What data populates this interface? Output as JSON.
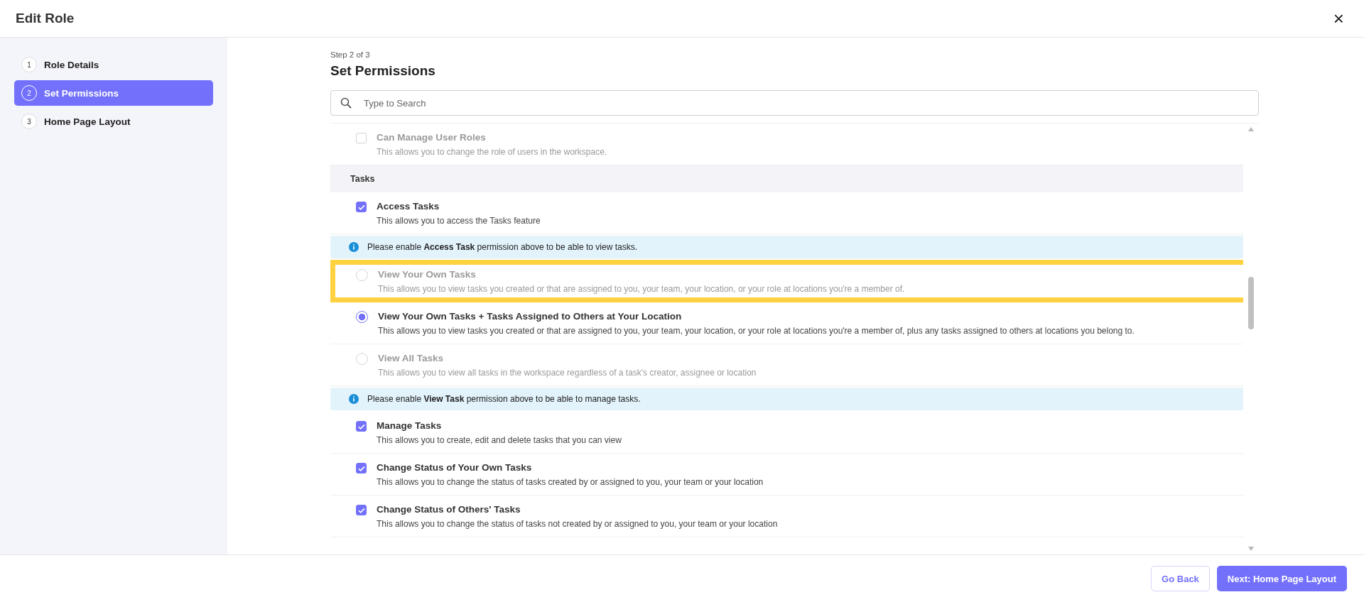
{
  "window": {
    "title": "Edit Role",
    "close": "×"
  },
  "steps": [
    {
      "number": "1",
      "label": "Role Details",
      "selected": false
    },
    {
      "number": "2",
      "label": "Set Permissions",
      "selected": true
    },
    {
      "number": "3",
      "label": "Home Page Layout",
      "selected": false
    }
  ],
  "content": {
    "step_label": "Step 2 of 3",
    "title": "Set Permissions"
  },
  "search": {
    "placeholder": "Type to Search"
  },
  "permissions": [
    {
      "kind": "checkbox",
      "title": "Can Manage User Roles",
      "description": "This allows you to change the role of users in the workspace.",
      "checked": false,
      "disabled": true
    },
    {
      "kind": "section",
      "title": "Tasks"
    },
    {
      "kind": "checkbox",
      "title": "Access Tasks",
      "description": "This allows you to access the Tasks feature",
      "checked": true,
      "disabled": false
    },
    {
      "kind": "info",
      "text": "Please enable **Access Task** permission above to be able to view tasks."
    },
    {
      "kind": "radio",
      "title": "View Your Own Tasks",
      "description": "This allows you to view tasks you created or that are assigned to you, your team, your location, or your role at locations you're a member of.",
      "selected": false,
      "disabled": true,
      "highlighted": true
    },
    {
      "kind": "radio",
      "title": "View Your Own Tasks + Tasks Assigned to Others at Your Location",
      "description": "This allows you to view tasks you created or that are assigned to you, your team, your location, or your role at locations you're a member of, plus any tasks assigned to others at locations you belong to.",
      "selected": true,
      "disabled": false,
      "highlighted": false
    },
    {
      "kind": "radio",
      "title": "View All Tasks",
      "description": "This allows you to view all tasks in the workspace regardless of a task's creator, assignee or location",
      "selected": false,
      "disabled": true,
      "highlighted": false
    },
    {
      "kind": "info",
      "text": "Please enable **View Task** permission above to be able to manage tasks."
    },
    {
      "kind": "checkbox",
      "title": "Manage Tasks",
      "description": "This allows you to create, edit and delete tasks that you can view",
      "checked": true,
      "disabled": false
    },
    {
      "kind": "checkbox",
      "title": "Change Status of Your Own Tasks",
      "description": "This allows you to change the status of tasks created by or assigned to you, your team or your location",
      "checked": true,
      "disabled": false
    },
    {
      "kind": "checkbox",
      "title": "Change Status of Others' Tasks",
      "description": "This allows you to change the status of tasks not created by or assigned to you, your team or your location",
      "checked": true,
      "disabled": false
    }
  ],
  "footer": {
    "back": "Go Back",
    "next": "Next: Home Page Layout"
  }
}
